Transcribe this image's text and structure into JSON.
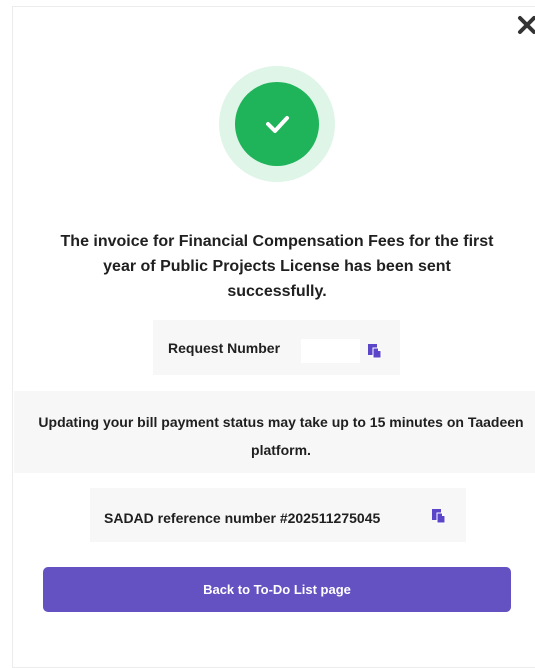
{
  "dialog": {
    "message": "The invoice for Financial Compensation Fees for the first year of Public Projects License has been sent successfully.",
    "request": {
      "label": "Request Number"
    },
    "notice": "Updating your bill payment status may take up to 15 minutes on Taadeen platform.",
    "sadad": {
      "text": "SADAD reference number #202511275045"
    },
    "back_button_label": "Back to To-Do List page"
  },
  "colors": {
    "success": "#1fb35a",
    "success_halo": "#dff5e8",
    "primary": "#6451c2",
    "copy_icon": "#5b46c9"
  },
  "icons": {
    "close": "close-icon",
    "success": "check-icon",
    "copy": "copy-icon"
  }
}
